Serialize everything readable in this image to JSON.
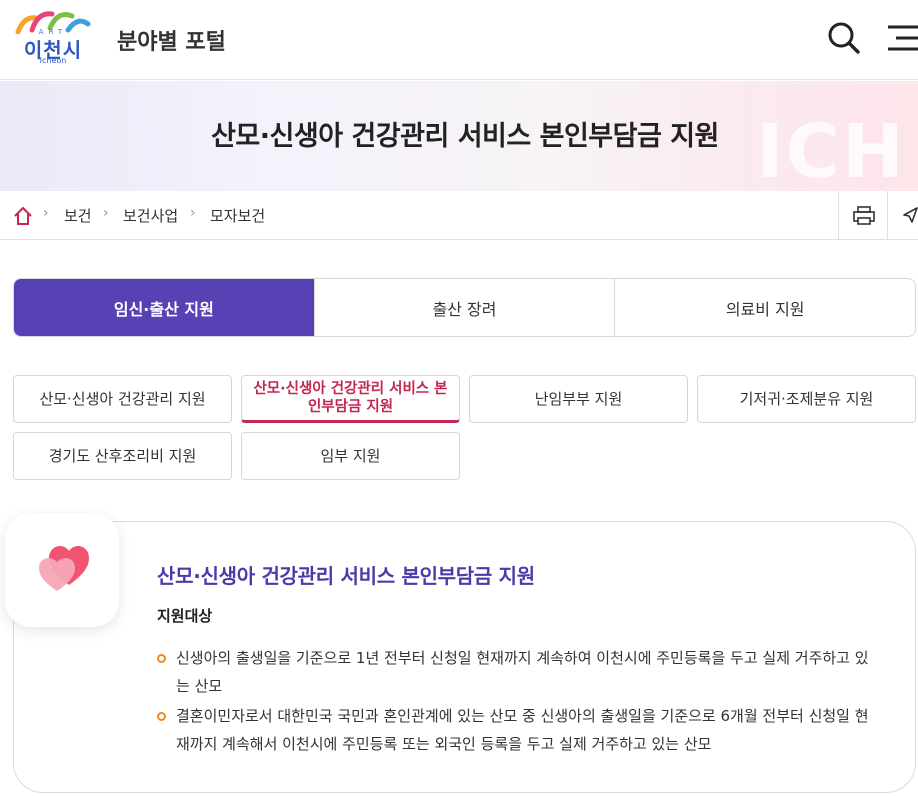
{
  "header": {
    "logo_art": "ART",
    "logo_city": "이천시",
    "logo_en": "Icheon",
    "portal_title": "분야별 포털",
    "colors": {
      "logo_blue": "#2e56c4"
    }
  },
  "banner": {
    "page_title": "산모·신생아 건강관리 서비스 본인부담금 지원",
    "watermark": "ICH"
  },
  "breadcrumb": {
    "items": [
      "보건",
      "보건사업",
      "모자보건"
    ],
    "home_icon": "home-icon",
    "tools": [
      "print-icon",
      "share-icon"
    ]
  },
  "tabs": [
    {
      "label": "임신·출산 지원",
      "active": true
    },
    {
      "label": "출산 장려",
      "active": false
    },
    {
      "label": "의료비 지원",
      "active": false
    }
  ],
  "subtabs": [
    {
      "label": "산모·신생아 건강관리 지원",
      "active": false
    },
    {
      "label": "산모·신생아 건강관리 서비스 본인부담금 지원",
      "active": true
    },
    {
      "label": "난임부부 지원",
      "active": false
    },
    {
      "label": "기저귀·조제분유 지원",
      "active": false
    },
    {
      "label": "경기도 산후조리비 지원",
      "active": false
    },
    {
      "label": "임부 지원",
      "active": false
    }
  ],
  "content": {
    "icon": "heart-icon",
    "title": "산모·신생아 건강관리 서비스 본인부담금 지원",
    "target_label": "지원대상",
    "bullets": [
      "신생아의 출생일을 기준으로 1년 전부터 신청일 현재까지 계속하여 이천시에 주민등록을 두고 실제 거주하고 있는 산모",
      "결혼이민자로서 대한민국 국민과 혼인관계에 있는 산모 중 신생아의 출생일을 기준으로 6개월 전부터 신청일 현재까지 계속해서 이천시에 주민등록 또는 외국인 등록을 두고 실제 거주하고 있는 산모"
    ]
  },
  "colors": {
    "accent_purple": "#5741b5",
    "active_subtab": "#c3264f",
    "bullet_orange": "#f08a1c",
    "title_purple": "#4b3aa8"
  }
}
